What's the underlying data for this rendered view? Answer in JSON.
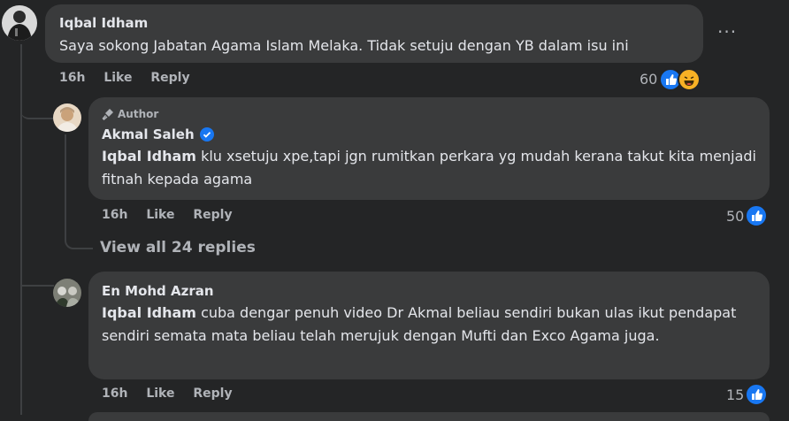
{
  "comment1": {
    "author": "Iqbal Idham",
    "text": "Saya sokong Jabatan Agama Islam Melaka. Tidak setuju dengan YB dalam isu ini",
    "time": "16h",
    "like_label": "Like",
    "reply_label": "Reply",
    "reaction_count": "60",
    "reactions": [
      "like-icon",
      "haha-icon"
    ],
    "more_label": "···"
  },
  "reply1": {
    "badge": "Author",
    "author": "Akmal Saleh",
    "verified": true,
    "mention": "Iqbal Idham",
    "text": " klu xsetuju xpe,tapi jgn rumitkan perkara yg mudah kerana takut kita menjadi fitnah kepada agama",
    "time": "16h",
    "like_label": "Like",
    "reply_label": "Reply",
    "reaction_count": "50",
    "reactions": [
      "like-icon"
    ]
  },
  "view_all": "View all 24 replies",
  "reply2": {
    "author": "En Mohd Azran",
    "mention": "Iqbal Idham",
    "text": " cuba dengar penuh video Dr Akmal beliau sendiri bukan ulas ikut pendapat sendiri semata mata beliau telah merujuk dengan Mufti dan Exco Agama juga.",
    "time": "16h",
    "like_label": "Like",
    "reply_label": "Reply",
    "reaction_count": "15",
    "reactions": [
      "like-icon"
    ]
  },
  "colors": {
    "background": "#242526",
    "bubble": "#3a3b3c",
    "like_blue": "#1877f2",
    "haha_yellow": "#f7b125",
    "text_primary": "#e4e6eb",
    "text_secondary": "#b0b3b8"
  }
}
